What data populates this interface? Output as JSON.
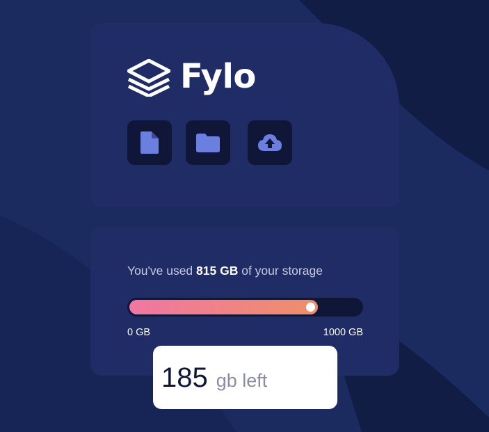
{
  "app": {
    "logo_text": "Fylo"
  },
  "toolbar": {
    "buttons": [
      {
        "icon": "document-icon"
      },
      {
        "icon": "folder-icon"
      },
      {
        "icon": "upload-icon"
      }
    ]
  },
  "storage": {
    "usage_prefix": "You've used ",
    "used_amount": "815 GB",
    "usage_suffix": " of your storage",
    "min_label": "0 GB",
    "max_label": "1000 GB",
    "used_fraction": 0.815,
    "remaining_value": "185",
    "remaining_unit": "gb left"
  },
  "colors": {
    "background": "#1b2a5f",
    "card": "#1f2c66",
    "button_bg": "#0f1638",
    "icon": "#6b7fe0",
    "gradient_start": "#f176a2",
    "gradient_end": "#ee8f6a"
  }
}
